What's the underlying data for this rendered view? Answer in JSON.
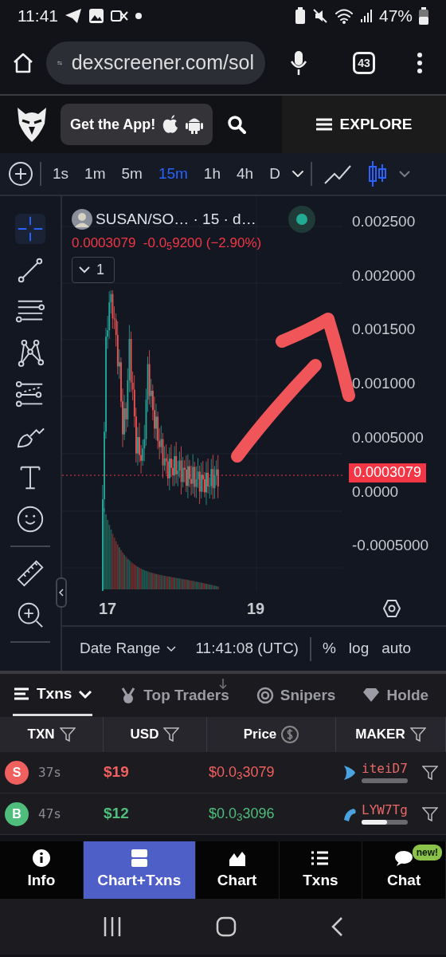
{
  "status_bar": {
    "time": "11:41",
    "battery": "47%"
  },
  "browser": {
    "url": "dexscreener.com/sol",
    "tab_count": "43"
  },
  "header": {
    "app_promo": "Get the App!",
    "explore": "EXPLORE"
  },
  "timeframes": [
    {
      "label": "1s",
      "selected": false
    },
    {
      "label": "1m",
      "selected": false
    },
    {
      "label": "5m",
      "selected": false
    },
    {
      "label": "15m",
      "selected": true
    },
    {
      "label": "1h",
      "selected": false
    },
    {
      "label": "4h",
      "selected": false
    },
    {
      "label": "D",
      "selected": false
    }
  ],
  "chart_types": [
    {
      "kind": "line",
      "selected": false
    },
    {
      "kind": "candles",
      "selected": true
    }
  ],
  "drawing_tools": [
    {
      "kind": "crosshair",
      "selected": true
    },
    {
      "kind": "trend-line",
      "selected": false
    },
    {
      "kind": "channel",
      "selected": false
    },
    {
      "kind": "pattern",
      "selected": false
    },
    {
      "kind": "fib",
      "selected": false
    },
    {
      "kind": "brush",
      "selected": false
    },
    {
      "kind": "text",
      "selected": false
    },
    {
      "kind": "emoji",
      "selected": false
    },
    {
      "kind": "separator"
    },
    {
      "kind": "ruler",
      "selected": false
    },
    {
      "kind": "zoom",
      "selected": false
    },
    {
      "kind": "separator"
    }
  ],
  "chart": {
    "title": "SUSAN/SO… · 15 · d…",
    "quote": "0.0003079  -0.0$_{5}$9200 (−2.90%)",
    "indicators": "1",
    "price_label": "0.0003079",
    "y_ticks": [
      "0.002500",
      "0.002000",
      "0.001500",
      "0.001000",
      "0.0005000",
      "0.0000",
      "-0.0005000"
    ],
    "x_ticks": [
      "17",
      "19"
    ]
  },
  "chart_footer": {
    "date_range": "Date Range",
    "time": "11:41:08 (UTC)",
    "options": [
      "%",
      "log",
      "auto"
    ]
  },
  "panel_tabs": [
    {
      "label": "Txns",
      "kind": "list",
      "selected": true
    },
    {
      "label": "Top Traders",
      "kind": "medal",
      "selected": false
    },
    {
      "label": "Snipers",
      "kind": "target",
      "selected": false
    },
    {
      "label": "Holde",
      "kind": "diamond",
      "selected": false
    }
  ],
  "table": {
    "columns": [
      {
        "label": "TXN",
        "kind": "filter"
      },
      {
        "label": "USD",
        "kind": "filter"
      },
      {
        "label": "Price",
        "kind": "currency"
      },
      {
        "label": "MAKER",
        "kind": "filter"
      }
    ],
    "rows": [
      {
        "kind": "sell",
        "badge": "S",
        "age": "37s",
        "usd": "$19",
        "price": "$0.0$_{3}$3079",
        "maker": "iteiD7",
        "level": 0
      },
      {
        "kind": "buy",
        "badge": "B",
        "age": "47s",
        "usd": "$12",
        "price": "$0.0$_{3}$3096",
        "maker": "LYW7Tg",
        "level": 0.55
      }
    ]
  },
  "bottom_nav": [
    {
      "label": "Info",
      "kind": "info",
      "selected": false
    },
    {
      "label": "Chart+Txns",
      "kind": "split",
      "selected": true
    },
    {
      "label": "Chart",
      "kind": "chart",
      "selected": false
    },
    {
      "label": "Txns",
      "kind": "list",
      "selected": false
    },
    {
      "label": "Chat",
      "kind": "chat",
      "selected": false,
      "badge": "new!"
    }
  ]
}
